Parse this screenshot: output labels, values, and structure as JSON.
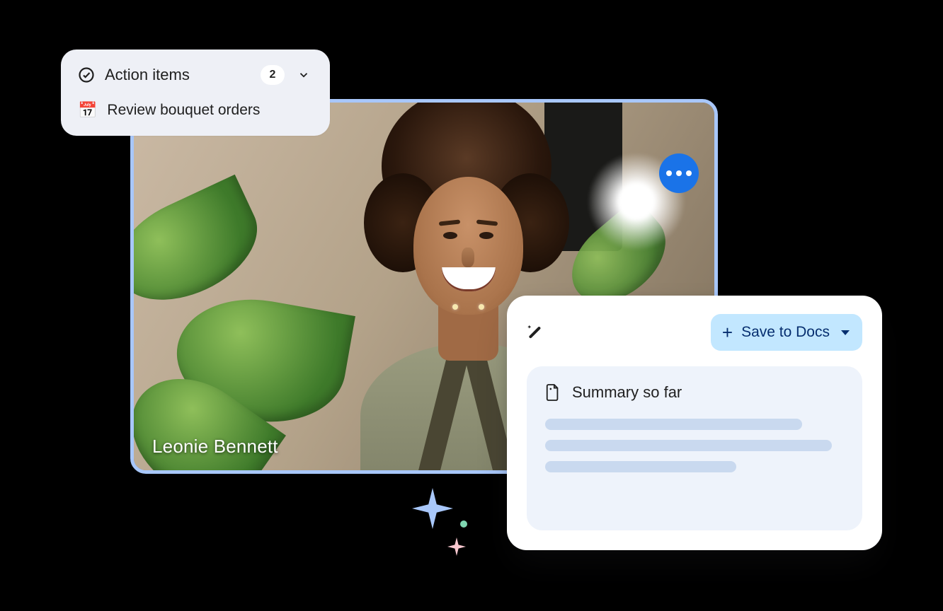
{
  "video": {
    "participant_name": "Leonie Bennett"
  },
  "action_items": {
    "title": "Action items",
    "count": "2",
    "items": [
      {
        "icon": "📅",
        "text": "Review bouquet orders"
      }
    ]
  },
  "summary_panel": {
    "save_button_label": "Save to Docs",
    "section_title": "Summary so far"
  },
  "colors": {
    "video_border": "#a8c7fa",
    "more_button_bg": "#1a73e8",
    "save_button_bg": "#c2e7ff",
    "summary_body_bg": "#eef3fb",
    "action_card_bg": "#eef0f6"
  }
}
